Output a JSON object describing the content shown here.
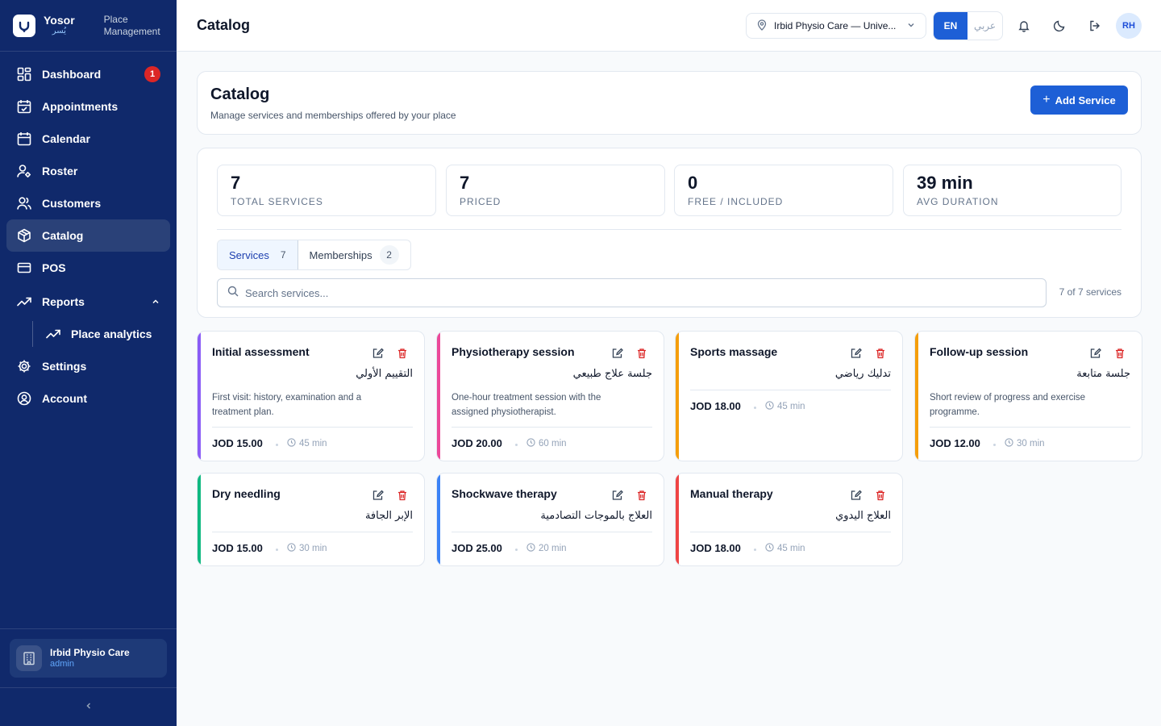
{
  "brand": {
    "name": "Yosor",
    "name_ar": "يُسر",
    "subtitle_line1": "Place",
    "subtitle_line2": "Management"
  },
  "sidebar": {
    "items": [
      {
        "label": "Dashboard",
        "icon": "grid-icon",
        "badge": "1"
      },
      {
        "label": "Appointments",
        "icon": "calendar-check-icon"
      },
      {
        "label": "Calendar",
        "icon": "calendar-icon"
      },
      {
        "label": "Roster",
        "icon": "user-cog-icon"
      },
      {
        "label": "Customers",
        "icon": "users-icon"
      },
      {
        "label": "Catalog",
        "icon": "package-icon",
        "active": true
      },
      {
        "label": "POS",
        "icon": "credit-card-icon"
      },
      {
        "label": "Reports",
        "icon": "trending-up-icon",
        "expanded": true
      },
      {
        "label": "Place analytics",
        "icon": "trending-up-icon",
        "sub": true
      },
      {
        "label": "Settings",
        "icon": "gear-icon"
      },
      {
        "label": "Account",
        "icon": "user-circle-icon"
      }
    ],
    "place": {
      "name": "Irbid Physio Care",
      "role": "admin"
    }
  },
  "topbar": {
    "title": "Catalog",
    "location": "Irbid Physio Care — Unive...",
    "lang_en": "EN",
    "lang_ar": "عربي",
    "avatar": "RH"
  },
  "header": {
    "title": "Catalog",
    "subtitle": "Manage services and memberships offered by your place",
    "add_button": "Add Service"
  },
  "stats": [
    {
      "value": "7",
      "label": "Total services"
    },
    {
      "value": "7",
      "label": "Priced"
    },
    {
      "value": "0",
      "label": "Free / included"
    },
    {
      "value": "39 min",
      "label": "Avg duration"
    }
  ],
  "tabs": [
    {
      "label": "Services",
      "count": "7"
    },
    {
      "label": "Memberships",
      "count": "2"
    }
  ],
  "search": {
    "placeholder": "Search services...",
    "result_count": "7 of 7 services"
  },
  "services": [
    {
      "name": "Initial assessment",
      "name_ar": "التقييم الأولي",
      "description": "First visit: history, examination and a treatment plan.",
      "price": "JOD 15.00",
      "duration": "45 min",
      "accent": "#8b5cf6"
    },
    {
      "name": "Physiotherapy session",
      "name_ar": "جلسة علاج طبيعي",
      "description": "One-hour treatment session with the assigned physiotherapist.",
      "price": "JOD 20.00",
      "duration": "60 min",
      "accent": "#ec4899"
    },
    {
      "name": "Sports massage",
      "name_ar": "تدليك رياضي",
      "description": "",
      "price": "JOD 18.00",
      "duration": "45 min",
      "accent": "#f59e0b"
    },
    {
      "name": "Follow-up session",
      "name_ar": "جلسة متابعة",
      "description": "Short review of progress and exercise programme.",
      "price": "JOD 12.00",
      "duration": "30 min",
      "accent": "#f59e0b"
    },
    {
      "name": "Dry needling",
      "name_ar": "الإبر الجافة",
      "description": "",
      "price": "JOD 15.00",
      "duration": "30 min",
      "accent": "#10b981"
    },
    {
      "name": "Shockwave therapy",
      "name_ar": "العلاج بالموجات التصادمية",
      "description": "",
      "price": "JOD 25.00",
      "duration": "20 min",
      "accent": "#3b82f6"
    },
    {
      "name": "Manual therapy",
      "name_ar": "العلاج اليدوي",
      "description": "",
      "price": "JOD 18.00",
      "duration": "45 min",
      "accent": "#ef4444"
    }
  ]
}
